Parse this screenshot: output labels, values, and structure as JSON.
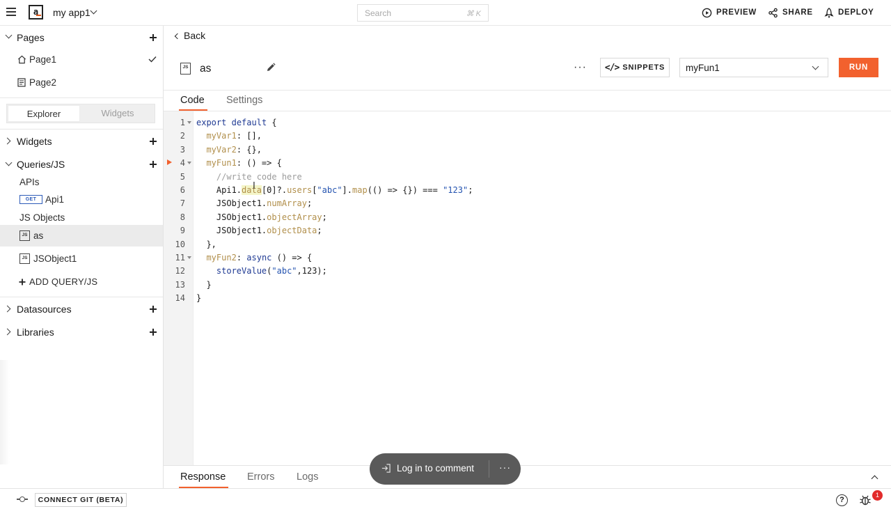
{
  "topbar": {
    "app_name": "my app1",
    "search_placeholder": "Search",
    "search_shortcut": "⌘ K",
    "preview_label": "PREVIEW",
    "share_label": "SHARE",
    "deploy_label": "DEPLOY"
  },
  "sidebar": {
    "pages_label": "Pages",
    "pages": [
      {
        "label": "Page1",
        "icon": "home-icon",
        "selected": true
      },
      {
        "label": "Page2",
        "icon": "page-icon",
        "selected": false
      }
    ],
    "toggle": {
      "explorer": "Explorer",
      "widgets": "Widgets",
      "active": "Explorer"
    },
    "widgets_label": "Widgets",
    "queries_label": "Queries/JS",
    "apis_label": "APIs",
    "api_items": [
      {
        "method": "GET",
        "label": "Api1"
      }
    ],
    "js_objects_label": "JS Objects",
    "js_badge": "JS",
    "js_items": [
      {
        "label": "as",
        "selected": true
      },
      {
        "label": "JSObject1",
        "selected": false
      }
    ],
    "add_query_label": "ADD QUERY/JS",
    "datasources_label": "Datasources",
    "libraries_label": "Libraries"
  },
  "main": {
    "back_label": "Back",
    "object_name": "as",
    "object_badge": "JS",
    "more_dots": "···",
    "snippets_icon": "</>",
    "snippets_label": "SNIPPETS",
    "function_select": "myFun1",
    "run_label": "RUN",
    "tabs": [
      {
        "label": "Code",
        "active": true
      },
      {
        "label": "Settings",
        "active": false
      }
    ]
  },
  "editor": {
    "line_numbers": [
      "1",
      "2",
      "3",
      "4",
      "5",
      "6",
      "7",
      "8",
      "9",
      "10",
      "11",
      "12",
      "13",
      "14"
    ],
    "fold_lines": [
      1,
      4,
      11
    ],
    "run_marker_line": 4,
    "code_lines": [
      "export default {",
      "  myVar1: [],",
      "  myVar2: {},",
      "  myFun1: () => {",
      "    //write code here",
      "    Api1.data[0]?.users[\"abc\"].map(() => {}) === \"123\";",
      "    JSObject1.numArray;",
      "    JSObject1.objectArray;",
      "    JSObject1.objectData;",
      "  },",
      "  myFun2: async () => {",
      "    storeValue(\"abc\",123);",
      "  }",
      "}"
    ]
  },
  "response": {
    "tabs": [
      {
        "label": "Response",
        "active": true
      },
      {
        "label": "Errors",
        "active": false
      },
      {
        "label": "Logs",
        "active": false
      }
    ]
  },
  "comment_pill": {
    "label": "Log in to comment",
    "more": "···"
  },
  "bottombar": {
    "connect_git_label": "CONNECT GIT (BETA)",
    "help_glyph": "?",
    "debugger_badge": "1"
  },
  "colors": {
    "accent": "#f2612e",
    "keyword": "#1f3a93",
    "property": "#b18f4b",
    "string": "#2453b0",
    "comment": "#9c9c9c",
    "badge": "#e22c2c",
    "get_method": "#2d5bb8"
  }
}
